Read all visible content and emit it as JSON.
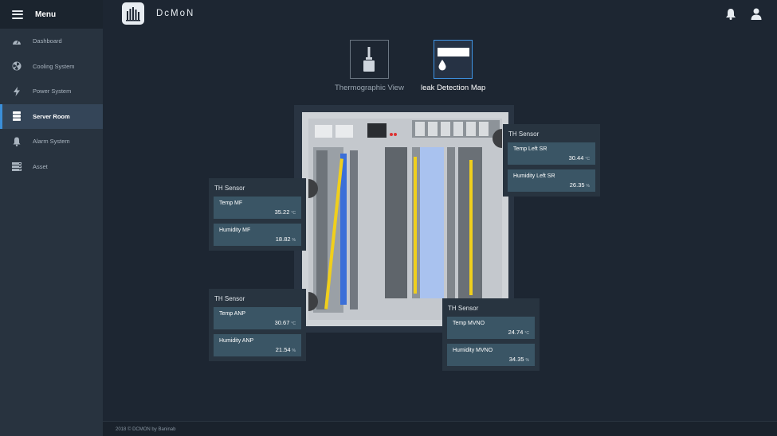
{
  "sidebar": {
    "title": "Menu",
    "items": [
      {
        "label": "Dashboard",
        "icon": "dashboard-icon"
      },
      {
        "label": "Cooling System",
        "icon": "fan-icon"
      },
      {
        "label": "Power System",
        "icon": "bolt-icon"
      },
      {
        "label": "Server Room",
        "icon": "server-icon",
        "active": true
      },
      {
        "label": "Alarm System",
        "icon": "bell-icon"
      },
      {
        "label": "Asset",
        "icon": "asset-icon"
      }
    ]
  },
  "header": {
    "app_name": "DcMoN",
    "icons": [
      "notification-bell-icon",
      "user-icon"
    ]
  },
  "views": [
    {
      "label": "Thermographic View",
      "icon": "brush-icon",
      "active": false
    },
    {
      "label": "leak Detection Map",
      "icon": "leak-drop-icon",
      "active": true
    }
  ],
  "sensors": {
    "mf": {
      "title": "TH Sensor",
      "temp": {
        "label": "Temp MF",
        "value": "35.22",
        "unit": "°C"
      },
      "hum": {
        "label": "Humidity MF",
        "value": "18.82",
        "unit": "%"
      }
    },
    "anp": {
      "title": "TH Sensor",
      "temp": {
        "label": "Temp ANP",
        "value": "30.67",
        "unit": "°C"
      },
      "hum": {
        "label": "Humidity ANP",
        "value": "21.54",
        "unit": "%"
      }
    },
    "left_sr": {
      "title": "TH Sensor",
      "temp": {
        "label": "Temp Left SR",
        "value": "30.44",
        "unit": "°C"
      },
      "hum": {
        "label": "Humidity Left SR",
        "value": "26.35",
        "unit": "%"
      }
    },
    "mvno": {
      "title": "TH Sensor",
      "temp": {
        "label": "Temp MVNO",
        "value": "24.74",
        "unit": "°C"
      },
      "hum": {
        "label": "Humidity MVNO",
        "value": "34.35",
        "unit": "%"
      }
    }
  },
  "colors": {
    "accent": "#3b8fd9",
    "sidebar": "#28333f",
    "background": "#1d2632",
    "card": "#3a5565",
    "leak_line": "#f0cf1c"
  },
  "footer": {
    "text": "2018 © DCMON by Baninab"
  }
}
